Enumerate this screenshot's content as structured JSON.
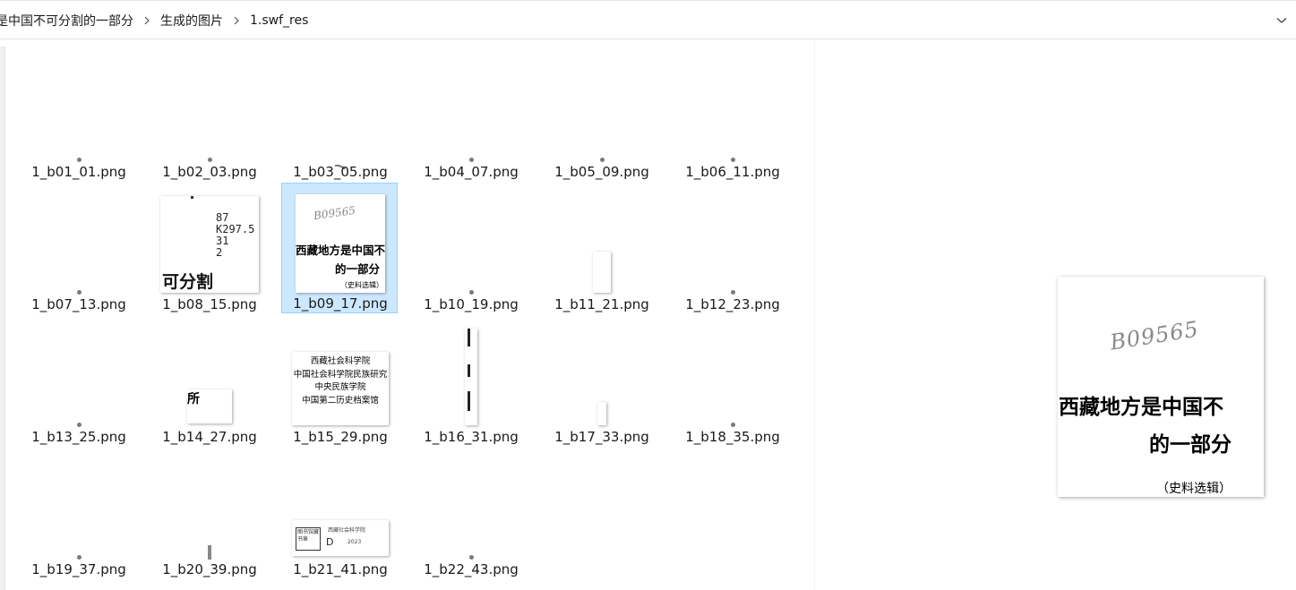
{
  "breadcrumb": {
    "items": [
      "是中国不可分割的一部分",
      "生成的图片",
      "1.swf_res"
    ]
  },
  "icons": {
    "separator": "chevron-right-icon",
    "dropdown": "chevron-down-icon"
  },
  "files": [
    {
      "name": "1_b01_01.png",
      "thumb": "dot"
    },
    {
      "name": "1_b02_03.png",
      "thumb": "dot"
    },
    {
      "name": "1_b03_05.png",
      "thumb": "swoosh"
    },
    {
      "name": "1_b04_07.png",
      "thumb": "dot"
    },
    {
      "name": "1_b05_09.png",
      "thumb": "dot"
    },
    {
      "name": "1_b06_11.png",
      "thumb": "dot"
    },
    {
      "name": "1_b07_13.png",
      "thumb": "dot"
    },
    {
      "name": "1_b08_15.png",
      "thumb": "doc"
    },
    {
      "name": "1_b09_17.png",
      "thumb": "cover",
      "selected": true
    },
    {
      "name": "1_b10_19.png",
      "thumb": "dot"
    },
    {
      "name": "1_b11_21.png",
      "thumb": "blank"
    },
    {
      "name": "1_b12_23.png",
      "thumb": "dot"
    },
    {
      "name": "1_b13_25.png",
      "thumb": "dot"
    },
    {
      "name": "1_b14_27.png",
      "thumb": "char"
    },
    {
      "name": "1_b15_29.png",
      "thumb": "institutions"
    },
    {
      "name": "1_b16_31.png",
      "thumb": "strip"
    },
    {
      "name": "1_b17_33.png",
      "thumb": "blank-small"
    },
    {
      "name": "1_b18_35.png",
      "thumb": "dot"
    },
    {
      "name": "1_b19_37.png",
      "thumb": "dot"
    },
    {
      "name": "1_b20_39.png",
      "thumb": "line"
    },
    {
      "name": "1_b21_41.png",
      "thumb": "stamp"
    },
    {
      "name": "1_b22_43.png",
      "thumb": "dot"
    }
  ],
  "thumb_text": {
    "b08_ref": "87\nK297.5\n31\n2",
    "b08_big": "可分割",
    "b09_scribble": "B09565",
    "b09_line1": "西藏地方是中国不",
    "b09_line2": "的一部分",
    "b09_line3": "（史料选辑）",
    "b14_char": "所",
    "b15_lines": [
      "西藏社会科学院",
      "中国社会科学院民族研究",
      "中央民族学院",
      "中国第二历史档案馆"
    ],
    "b21_stamp": "图书馆藏书章",
    "b21_small": "西藏社会科学院",
    "b21_d": "D",
    "b21_year": "2023"
  },
  "preview": {
    "scribble": "B09565",
    "line1": "西藏地方是中国不",
    "line2": "的一部分",
    "line3": "（史料选辑）"
  },
  "colors": {
    "selection_bg": "#cce8ff",
    "selection_border": "#99d1ff"
  }
}
